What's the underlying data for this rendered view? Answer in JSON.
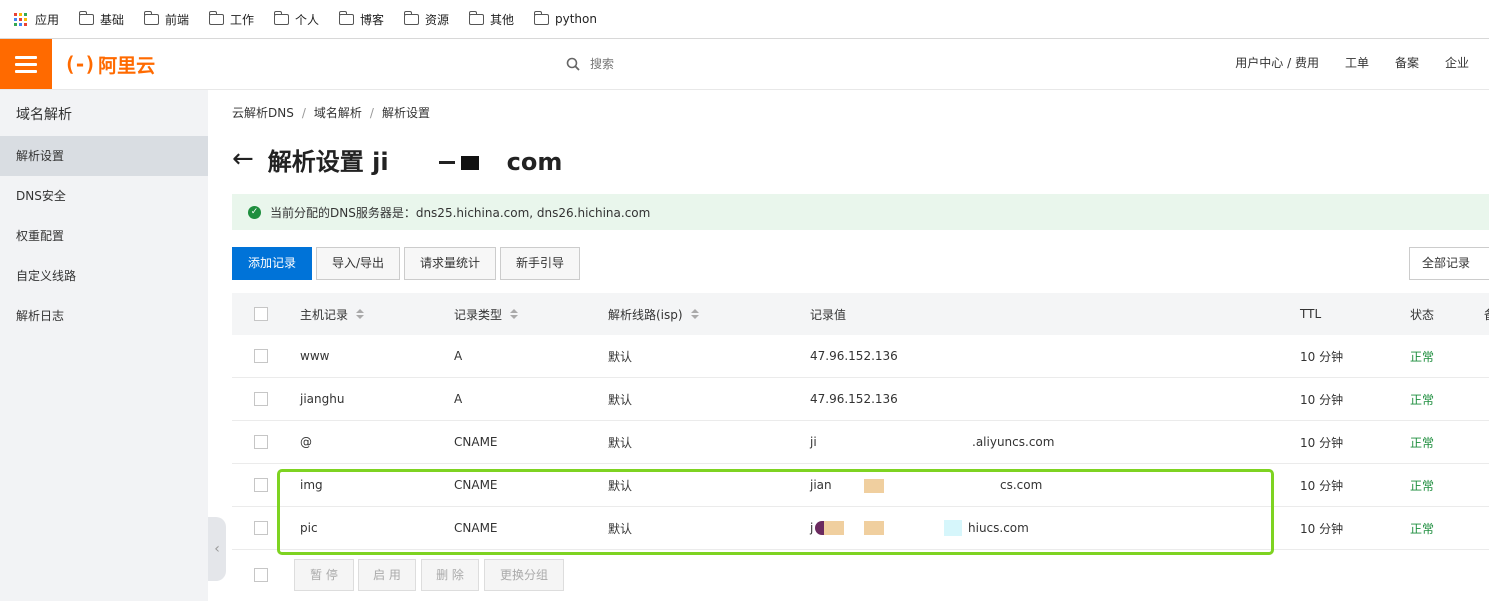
{
  "bookmarks": {
    "apps_label": "应用",
    "items": [
      "基础",
      "前端",
      "工作",
      "个人",
      "博客",
      "资源",
      "其他",
      "python"
    ]
  },
  "topbar": {
    "logo_mark": "(-)",
    "logo_text": "阿里云",
    "search_placeholder": "搜索",
    "nav": [
      "用户中心 / 费用",
      "工单",
      "备案",
      "企业"
    ],
    "accent": "#ff6a00"
  },
  "sidebar": {
    "title": "域名解析",
    "items": [
      "解析设置",
      "DNS安全",
      "权重配置",
      "自定义线路",
      "解析日志"
    ],
    "active_index": 0,
    "collapse_glyph": "‹"
  },
  "breadcrumb": [
    "云解析DNS",
    "域名解析",
    "解析设置"
  ],
  "page": {
    "back_glyph": "←",
    "title": "解析设置 ji",
    "title_suffix": "com"
  },
  "alert": {
    "icon": "check-icon",
    "text": "当前分配的DNS服务器是：dns25.hichina.com, dns26.hichina.com"
  },
  "toolbar": {
    "add": "添加记录",
    "import_export": "导入/导出",
    "stats": "请求量统计",
    "guide": "新手引导",
    "filter": "全部记录"
  },
  "table": {
    "headers": {
      "host": "主机记录",
      "type": "记录类型",
      "line": "解析线路(isp)",
      "value": "记录值",
      "ttl": "TTL",
      "status": "状态",
      "extra": "备"
    },
    "rows": [
      {
        "host": "www",
        "type": "A",
        "line": "默认",
        "value": "47.96.152.136",
        "ttl": "10 分钟",
        "status": "正常"
      },
      {
        "host": "jianghu",
        "type": "A",
        "line": "默认",
        "value": "47.96.152.136",
        "ttl": "10 分钟",
        "status": "正常"
      },
      {
        "host": "@",
        "type": "CNAME",
        "line": "默认",
        "value": "ji",
        "value_tail": ".aliyuncs.com",
        "ttl": "10 分钟",
        "status": "正常"
      },
      {
        "host": "img",
        "type": "CNAME",
        "line": "默认",
        "value": "jian",
        "value_tail": "cs.com",
        "ttl": "10 分钟",
        "status": "正常"
      },
      {
        "host": "pic",
        "type": "CNAME",
        "line": "默认",
        "value": "j",
        "value_tail": "hiucs.com",
        "ttl": "10 分钟",
        "status": "正常"
      }
    ],
    "status_color": "#1e8e3e"
  },
  "footer_actions": {
    "pause": "暂 停",
    "enable": "启 用",
    "delete": "删 除",
    "regroup": "更换分组"
  },
  "colors": {
    "primary": "#0073d8",
    "highlight": "#7ed321"
  }
}
